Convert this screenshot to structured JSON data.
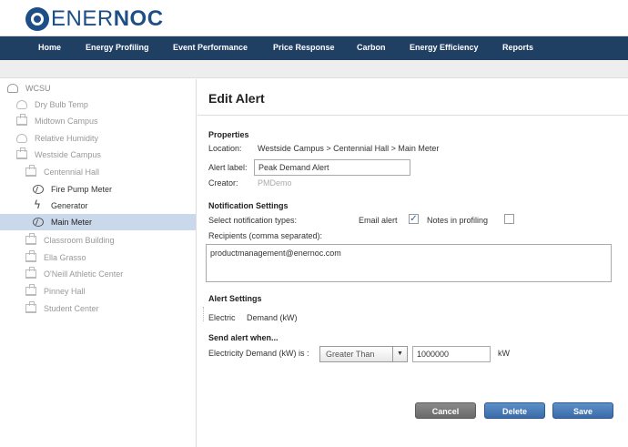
{
  "brand": {
    "name_light": "ENER",
    "name_bold": "NOC",
    "color": "#1d4f86"
  },
  "nav": {
    "items": [
      "Home",
      "Energy Profiling",
      "Event Performance",
      "Price Response",
      "Carbon",
      "Energy Efficiency",
      "Reports"
    ],
    "bg_color": "#1f3f63"
  },
  "sidebar": {
    "root": "WCSU",
    "items": [
      {
        "label": "Dry Bulb Temp",
        "icon": "cloud-icon"
      },
      {
        "label": "Midtown Campus",
        "icon": "building-icon"
      },
      {
        "label": "Relative Humidity",
        "icon": "cloud-icon"
      },
      {
        "label": "Westside Campus",
        "icon": "building-icon"
      },
      {
        "label": "Centennial Hall",
        "icon": "building-icon"
      },
      {
        "label": "Fire Pump Meter",
        "icon": "meter-icon"
      },
      {
        "label": "Generator",
        "icon": "bolt-icon"
      },
      {
        "label": "Main Meter",
        "icon": "meter-icon",
        "selected": true
      },
      {
        "label": "Classroom Building",
        "icon": "building-icon"
      },
      {
        "label": "Ella Grasso",
        "icon": "building-icon"
      },
      {
        "label": "O'Neill Athletic Center",
        "icon": "building-icon"
      },
      {
        "label": "Pinney Hall",
        "icon": "building-icon"
      },
      {
        "label": "Student Center",
        "icon": "building-icon"
      }
    ]
  },
  "main": {
    "title": "Edit Alert",
    "properties": {
      "heading": "Properties",
      "location_label": "Location:",
      "location_value": "Westside Campus > Centennial Hall > Main Meter",
      "alert_label_label": "Alert label:",
      "alert_label_value": "Peak Demand Alert",
      "creator_label": "Creator:",
      "creator_value": "PMDemo"
    },
    "notification": {
      "heading": "Notification Settings",
      "select_types_label": "Select notification types:",
      "email_alert_label": "Email alert",
      "email_alert_checked": true,
      "notes_label": "Notes in profiling",
      "notes_checked": false,
      "recipients_label": "Recipients (comma separated):",
      "recipients_value": "productmanagement@enernoc.com"
    },
    "alert_settings": {
      "heading": "Alert Settings",
      "type": "Electric",
      "measure": "Demand (kW)"
    },
    "send_when": {
      "heading": "Send alert when...",
      "condition_label": "Electricity Demand (kW) is :",
      "operator": "Greater Than",
      "threshold": "1000000",
      "unit": "kW"
    },
    "buttons": {
      "cancel": "Cancel",
      "delete": "Delete",
      "save": "Save"
    }
  }
}
